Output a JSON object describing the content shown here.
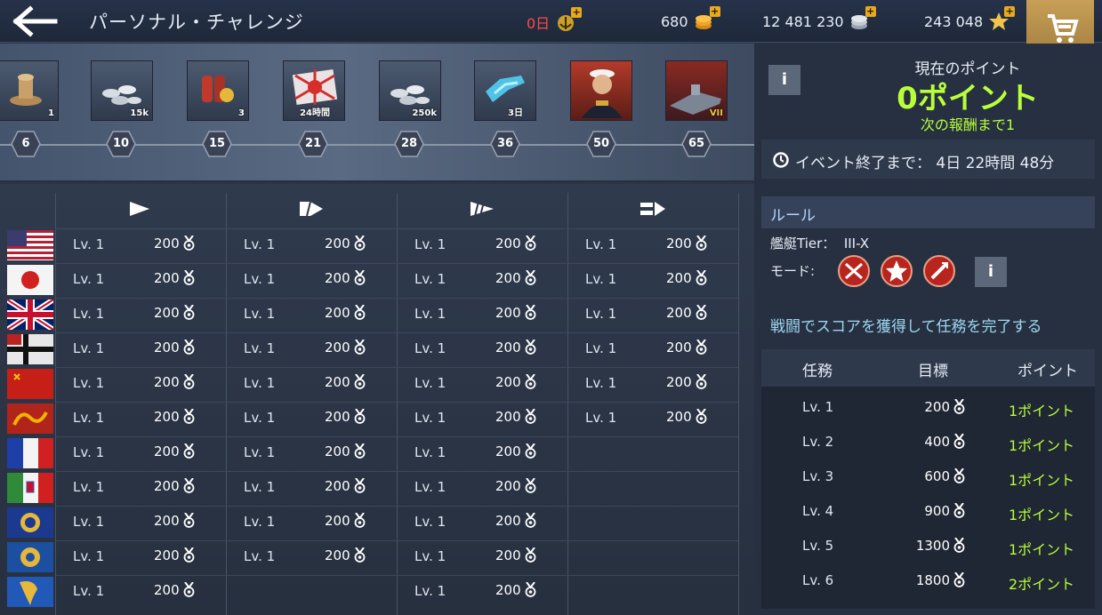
{
  "header": {
    "title": "パーソナル・チャレンジ",
    "currencies": [
      {
        "value": "0日",
        "icon": "vip-anchor-icon",
        "color": "#ff4a4a"
      },
      {
        "value": "680",
        "icon": "gold-coins-icon"
      },
      {
        "value": "12 481 230",
        "icon": "silver-coins-icon"
      },
      {
        "value": "243 048",
        "icon": "star-icon"
      }
    ]
  },
  "rewards": [
    {
      "qty": "1",
      "icon": "rope-capstan-icon"
    },
    {
      "qty": "15k",
      "icon": "silver-coins-icon"
    },
    {
      "qty": "3",
      "icon": "repair-kit-icon"
    },
    {
      "qty": "24時間",
      "icon": "premium-flag-icon"
    },
    {
      "qty": "250k",
      "icon": "silver-coins-icon"
    },
    {
      "qty": "3日",
      "icon": "camouflage-icon"
    },
    {
      "qty": "",
      "icon": "admiral-portrait-icon"
    },
    {
      "qty": "VII",
      "icon": "battleship-icon"
    }
  ],
  "milestones": [
    "6",
    "10",
    "15",
    "21",
    "28",
    "36",
    "50",
    "65"
  ],
  "nations": [
    {
      "name": "usa",
      "counts": 4
    },
    {
      "name": "japan",
      "counts": 4
    },
    {
      "name": "uk",
      "counts": 4
    },
    {
      "name": "germany",
      "counts": 4
    },
    {
      "name": "ussr",
      "counts": 4
    },
    {
      "name": "china",
      "counts": 4
    },
    {
      "name": "france",
      "counts": 3
    },
    {
      "name": "italy",
      "counts": 3
    },
    {
      "name": "pan-asia",
      "counts": 3
    },
    {
      "name": "commonwealth",
      "counts": 3
    },
    {
      "name": "pan-america",
      "counts": 2
    }
  ],
  "grid_cells": {
    "lv": "Lv. 1",
    "pts": "200"
  },
  "class_headers": [
    "destroyer-class-icon",
    "cruiser-class-icon",
    "battleship-class-icon",
    "carrier-class-icon"
  ],
  "panel": {
    "cur_points_label": "現在のポイント",
    "cur_points": "0ポイント",
    "next_reward": "次の報酬まで1",
    "timer_label": "イベント終了まで：",
    "timer_value": "4日 22時間 48分",
    "rules_title": "ルール",
    "tier_label": "艦艇Tier：",
    "tier_value": "III-X",
    "mode_label": "モード:",
    "task_desc": "戦闘でスコアを獲得して任務を完了する",
    "table_headers": {
      "task": "任務",
      "goal": "目標",
      "points": "ポイント"
    },
    "tasks": [
      {
        "lv": "Lv. 1",
        "goal": "200",
        "points": "1ポイント"
      },
      {
        "lv": "Lv. 2",
        "goal": "400",
        "points": "1ポイント"
      },
      {
        "lv": "Lv. 3",
        "goal": "600",
        "points": "1ポイント"
      },
      {
        "lv": "Lv. 4",
        "goal": "900",
        "points": "1ポイント"
      },
      {
        "lv": "Lv. 5",
        "goal": "1300",
        "points": "1ポイント"
      },
      {
        "lv": "Lv. 6",
        "goal": "1800",
        "points": "2ポイント"
      }
    ]
  },
  "colors": {
    "accent_green": "#b8ff3a",
    "cart_gold": "#c79f57",
    "warning_red": "#ff4a4a"
  }
}
